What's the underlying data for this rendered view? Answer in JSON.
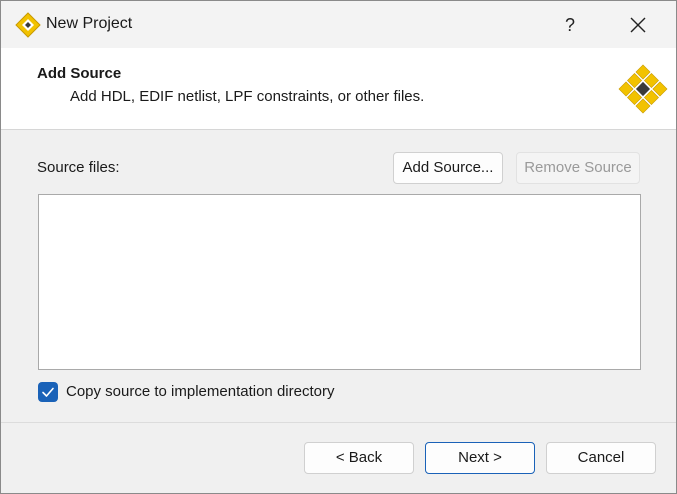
{
  "window": {
    "title": "New Project",
    "help_glyph": "?",
    "icons": {
      "app": "lattice-diamond-icon",
      "close": "close-icon"
    }
  },
  "header": {
    "title": "Add Source",
    "subtitle": "Add HDL, EDIF netlist, LPF constraints, or other files.",
    "logo_icon": "lattice-diamond-logo"
  },
  "source": {
    "label": "Source files:",
    "add_button": "Add Source...",
    "remove_button": "Remove Source",
    "files": []
  },
  "copy_option": {
    "label": "Copy source to implementation directory",
    "checked": true
  },
  "footer": {
    "back": "< Back",
    "next": "Next >",
    "cancel": "Cancel"
  },
  "colors": {
    "accent": "#1a62b8",
    "diamond_yellow": "#f2c200",
    "diamond_dark": "#3a3a3a"
  }
}
